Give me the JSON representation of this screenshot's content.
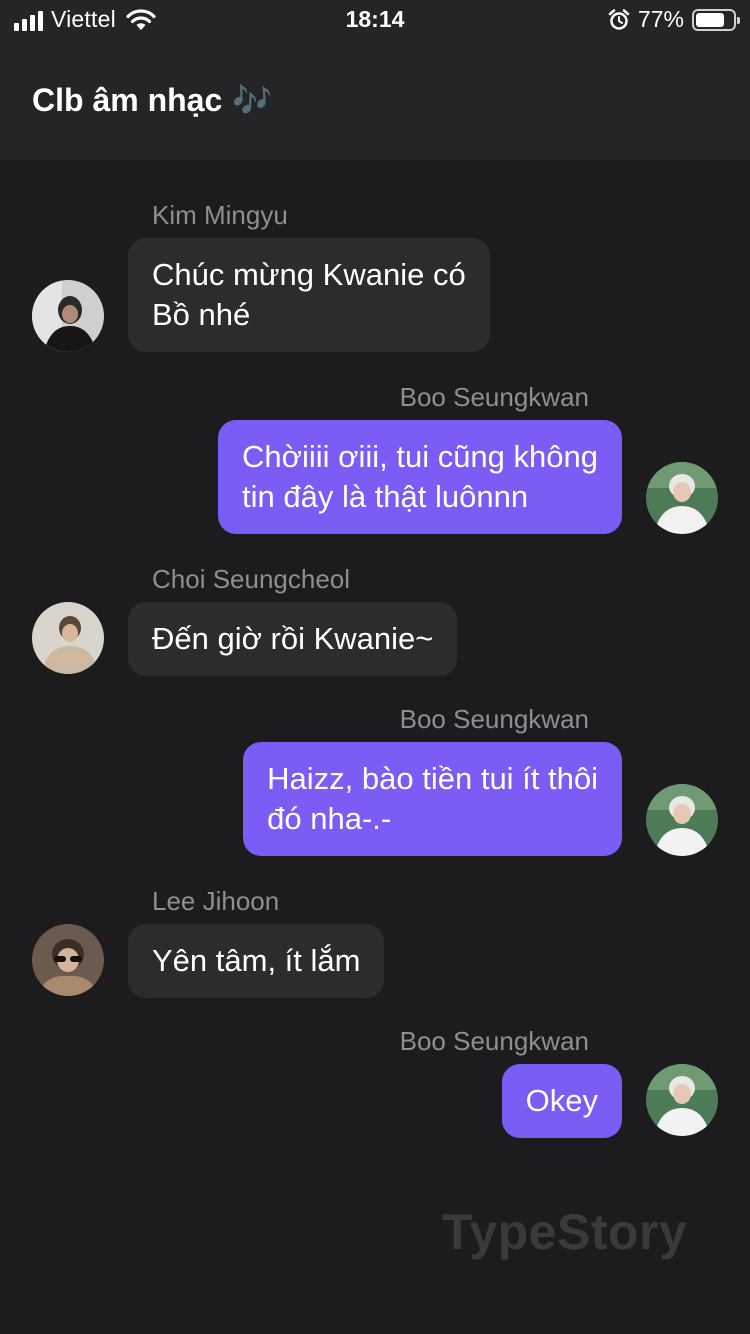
{
  "status_bar": {
    "carrier": "Viettel",
    "time": "18:14",
    "battery_percent": "77%",
    "battery_level": 0.77,
    "icons": [
      "signal-icon",
      "wifi-icon",
      "alarm-icon",
      "battery-icon"
    ]
  },
  "header": {
    "title": "Clb âm nhạc",
    "emoji": "🎶"
  },
  "messages": [
    {
      "sender": "Kim Mingyu",
      "text_lines": [
        "Chúc mừng Kwanie có",
        "Bồ nhé"
      ],
      "direction": "incoming"
    },
    {
      "sender": "Boo Seungkwan",
      "text_lines": [
        "Chờiiii ơiii, tui cũng không",
        "tin đây là thật luônnn"
      ],
      "direction": "outgoing"
    },
    {
      "sender": "Choi Seungcheol",
      "text_lines": [
        "Đến giờ rồi Kwanie~"
      ],
      "direction": "incoming"
    },
    {
      "sender": "Boo Seungkwan",
      "text_lines": [
        "Haizz, bào tiền tui ít thôi",
        "đó nha-.-"
      ],
      "direction": "outgoing"
    },
    {
      "sender": "Lee Jihoon",
      "text_lines": [
        "Yên tâm, ít lắm"
      ],
      "direction": "incoming"
    },
    {
      "sender": "Boo Seungkwan",
      "text_lines": [
        "Okey"
      ],
      "direction": "outgoing"
    }
  ],
  "watermark": "TypeStory",
  "colors": {
    "background": "#1c1c1e",
    "header": "#252527",
    "incoming_bubble": "#2c2c2e",
    "outgoing_bubble": "#7b5cf5",
    "sender_name": "#8e8e93"
  }
}
